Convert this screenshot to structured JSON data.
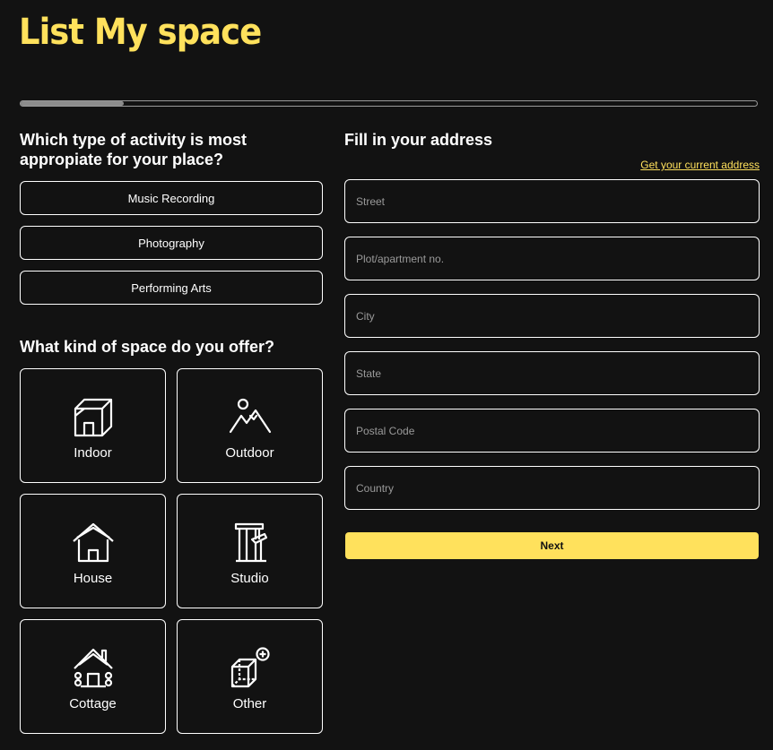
{
  "header": {
    "title": "List My space"
  },
  "progress": {
    "fraction": 0.14
  },
  "activity": {
    "heading": "Which type of activity is most appropiate for your place?",
    "options": [
      "Music Recording",
      "Photography",
      "Performing Arts"
    ]
  },
  "space": {
    "heading": "What kind of space do you offer?",
    "types": [
      {
        "label": "Indoor",
        "icon": "indoor-icon"
      },
      {
        "label": "Outdoor",
        "icon": "outdoor-icon"
      },
      {
        "label": "House",
        "icon": "house-icon"
      },
      {
        "label": "Studio",
        "icon": "studio-icon"
      },
      {
        "label": "Cottage",
        "icon": "cottage-icon"
      },
      {
        "label": "Other",
        "icon": "other-icon"
      }
    ]
  },
  "address": {
    "heading": "Fill in your address",
    "current_link": "Get your current address",
    "fields": {
      "street": "Street",
      "plot": "Plot/apartment no.",
      "city": "City",
      "state": "State",
      "postal": "Postal Code",
      "country": "Country"
    },
    "next_label": "Next"
  },
  "colors": {
    "accent": "#ffe15c",
    "background": "#121212",
    "border": "#ffffff"
  }
}
